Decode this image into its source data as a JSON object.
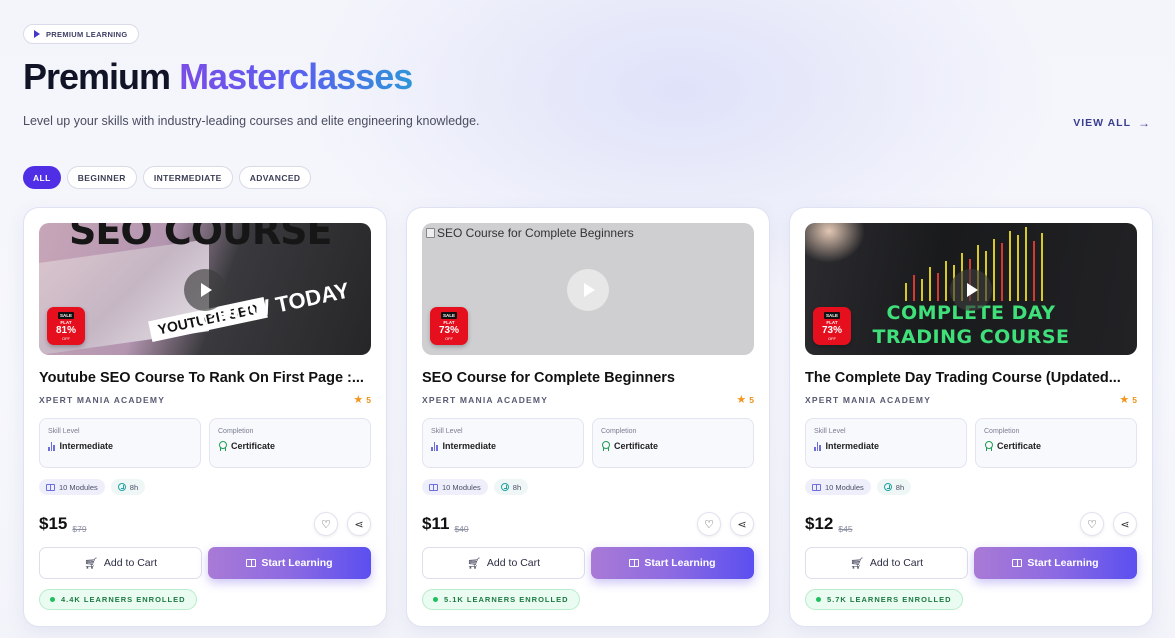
{
  "header": {
    "badge": "PREMIUM LEARNING",
    "title_main": "Premium ",
    "title_accent": "Masterclasses",
    "subtitle": "Level up your skills with industry-leading courses and elite engineering knowledge.",
    "view_all": "VIEW ALL",
    "view_all_icon": "arrow-right-icon"
  },
  "filters": [
    {
      "label": "ALL",
      "active": true
    },
    {
      "label": "BEGINNER",
      "active": false
    },
    {
      "label": "INTERMEDIATE",
      "active": false
    },
    {
      "label": "ADVANCED",
      "active": false
    }
  ],
  "colors": {
    "accent_purple": "#4f2ee6",
    "sale_red": "#e50f1d",
    "rating_orange": "#f0961e",
    "enrolled_green": "#1fbf5e"
  },
  "cards": [
    {
      "thumb": {
        "big_text": "SEO COURSE",
        "yt_text": "YOUTUBE SEO",
        "grow_text": "GROW TODAY",
        "sale": {
          "label": "SALE",
          "flat": "FLAT",
          "percent": "81%",
          "off": "OFF"
        }
      },
      "title": "Youtube SEO Course To Rank On First Page :...",
      "academy": "XPERT MANIA ACADEMY",
      "rating": "5",
      "skill_label": "Skill Level",
      "skill_value": "Intermediate",
      "completion_label": "Completion",
      "completion_value": "Certificate",
      "modules": "10 Modules",
      "duration": "8h",
      "price": "$15",
      "old_price": "$79",
      "add_to_cart": "Add to Cart",
      "start_learning": "Start Learning",
      "enrolled": "4.4K LEARNERS ENROLLED"
    },
    {
      "thumb": {
        "alt_text": "SEO Course for Complete Beginners",
        "sale": {
          "label": "SALE",
          "flat": "FLAT",
          "percent": "73%",
          "off": "OFF"
        }
      },
      "title": "SEO Course for Complete Beginners",
      "academy": "XPERT MANIA ACADEMY",
      "rating": "5",
      "skill_label": "Skill Level",
      "skill_value": "Intermediate",
      "completion_label": "Completion",
      "completion_value": "Certificate",
      "modules": "10 Modules",
      "duration": "8h",
      "price": "$11",
      "old_price": "$40",
      "add_to_cart": "Add to Cart",
      "start_learning": "Start Learning",
      "enrolled": "5.1K LEARNERS ENROLLED"
    },
    {
      "thumb": {
        "course_text_1": "COMPLETE DAY",
        "course_text_2": "TRADING COURSE",
        "sale": {
          "label": "SALE",
          "flat": "FLAT",
          "percent": "73%",
          "off": "OFF"
        }
      },
      "title": "The Complete Day Trading Course (Updated...",
      "academy": "XPERT MANIA ACADEMY",
      "rating": "5",
      "skill_label": "Skill Level",
      "skill_value": "Intermediate",
      "completion_label": "Completion",
      "completion_value": "Certificate",
      "modules": "10 Modules",
      "duration": "8h",
      "price": "$12",
      "old_price": "$45",
      "add_to_cart": "Add to Cart",
      "start_learning": "Start Learning",
      "enrolled": "5.7K LEARNERS ENROLLED"
    }
  ]
}
